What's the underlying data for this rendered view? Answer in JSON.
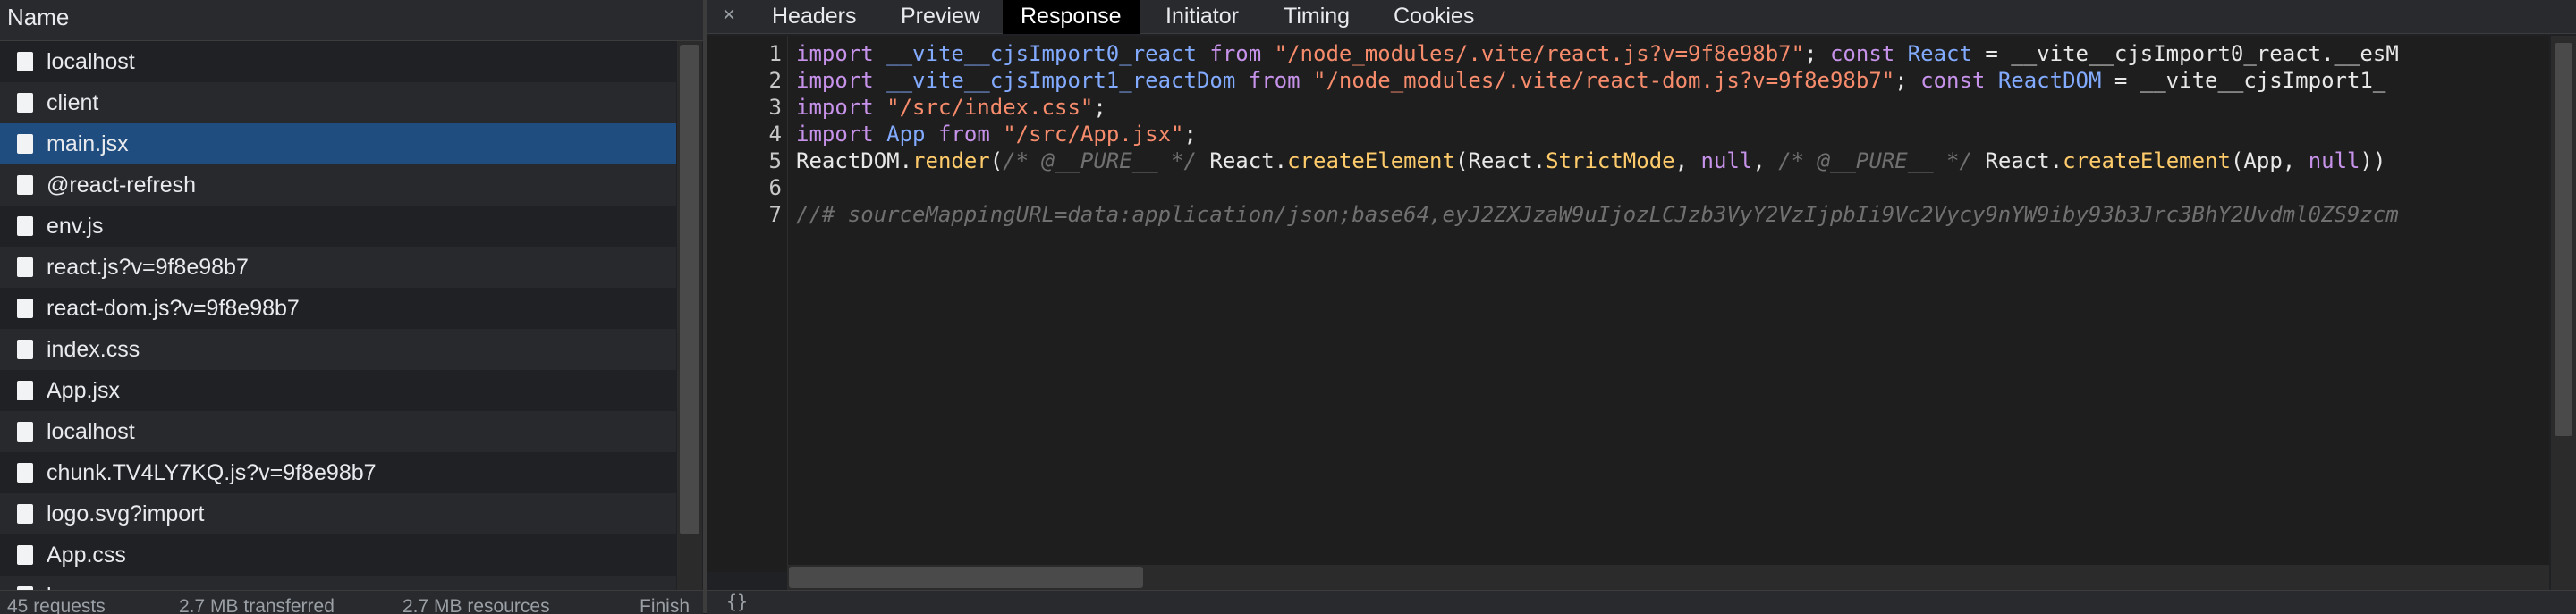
{
  "network": {
    "name_header": "Name",
    "files": [
      {
        "name": "localhost"
      },
      {
        "name": "client"
      },
      {
        "name": "main.jsx",
        "selected": true
      },
      {
        "name": "@react-refresh"
      },
      {
        "name": "env.js"
      },
      {
        "name": "react.js?v=9f8e98b7"
      },
      {
        "name": "react-dom.js?v=9f8e98b7"
      },
      {
        "name": "index.css"
      },
      {
        "name": "App.jsx"
      },
      {
        "name": "localhost"
      },
      {
        "name": "chunk.TV4LY7KQ.js?v=9f8e98b7"
      },
      {
        "name": "logo.svg?import"
      },
      {
        "name": "App.css"
      },
      {
        "name": "l..."
      }
    ],
    "status": {
      "requests": "45 requests",
      "transferred": "2.7 MB transferred",
      "resources": "2.7 MB resources",
      "finish": "Finish"
    }
  },
  "detail": {
    "close_glyph": "×",
    "tabs": [
      {
        "label": "Headers"
      },
      {
        "label": "Preview"
      },
      {
        "label": "Response",
        "active": true
      },
      {
        "label": "Initiator"
      },
      {
        "label": "Timing"
      },
      {
        "label": "Cookies"
      }
    ],
    "format_glyph": "{}"
  },
  "code_lines": [
    {
      "n": "1",
      "text": "import __vite__cjsImport0_react from \"/node_modules/.vite/react.js?v=9f8e98b7\"; const React = __vite__cjsImport0_react.__esM"
    },
    {
      "n": "2",
      "text": "import __vite__cjsImport1_reactDom from \"/node_modules/.vite/react-dom.js?v=9f8e98b7\"; const ReactDOM = __vite__cjsImport1_"
    },
    {
      "n": "3",
      "text": "import \"/src/index.css\";"
    },
    {
      "n": "4",
      "text": "import App from \"/src/App.jsx\";"
    },
    {
      "n": "5",
      "text": "ReactDOM.render(/* @__PURE__ */ React.createElement(React.StrictMode, null, /* @__PURE__ */ React.createElement(App, null))"
    },
    {
      "n": "6",
      "text": ""
    },
    {
      "n": "7",
      "text": "//# sourceMappingURL=data:application/json;base64,eyJ2ZXJzaW9uIjozLCJzb3VyY2VzIjpbIi9Vc2Vycy9nYW9iby93b3Jrc3BhY2Uvdml0ZS9zcm"
    }
  ],
  "colors": {
    "selected_row": "#1f4d7f",
    "keyword": "#c792ea",
    "identifier": "#82aaff",
    "string": "#f78c6c",
    "function": "#ffcb6b",
    "comment": "#707070"
  }
}
